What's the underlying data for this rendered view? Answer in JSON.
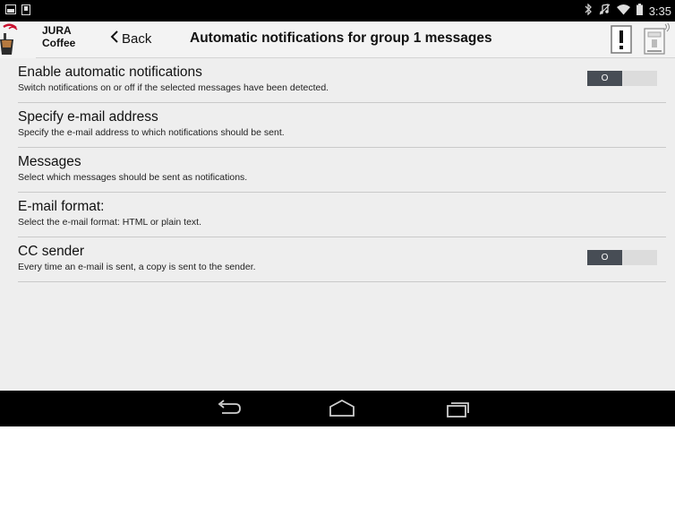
{
  "status_bar": {
    "time": "3:35",
    "left_icons": [
      "gallery-icon",
      "download-notification-icon"
    ],
    "right_icons": [
      "bluetooth-icon",
      "mute-icon",
      "wifi-icon",
      "battery-icon"
    ]
  },
  "app_bar": {
    "brand": "JURA\nCoffee",
    "back_label": "Back",
    "title": "Automatic notifications for group 1 messages",
    "action_icons": [
      "alert-icon",
      "coffee-machine-icon"
    ]
  },
  "settings": [
    {
      "title": "Enable automatic notifications",
      "description": "Switch notifications on or off if the selected messages have been detected.",
      "toggle_text": "O",
      "toggle_on": false
    },
    {
      "title": "Specify e-mail address",
      "description": "Specify the e-mail address to which notifications should be sent."
    },
    {
      "title": "Messages",
      "description": "Select which messages should be sent as notifications."
    },
    {
      "title": "E-mail format:",
      "description": "Select the e-mail format: HTML or plain text."
    },
    {
      "title": "CC sender",
      "description": "Every time an e-mail is sent, a copy is sent to the sender.",
      "toggle_text": "O",
      "toggle_on": false
    }
  ],
  "nav_bar": {
    "icons": [
      "back-arrow-icon",
      "home-icon",
      "recent-apps-icon"
    ]
  },
  "colors": {
    "status_bar": "#000000",
    "app_bar": "#f3f3f3",
    "content_background": "#eeeeee",
    "toggle_knob": "#474d55",
    "toggle_track": "#dcdcdc",
    "brand_red": "#c8102e"
  }
}
